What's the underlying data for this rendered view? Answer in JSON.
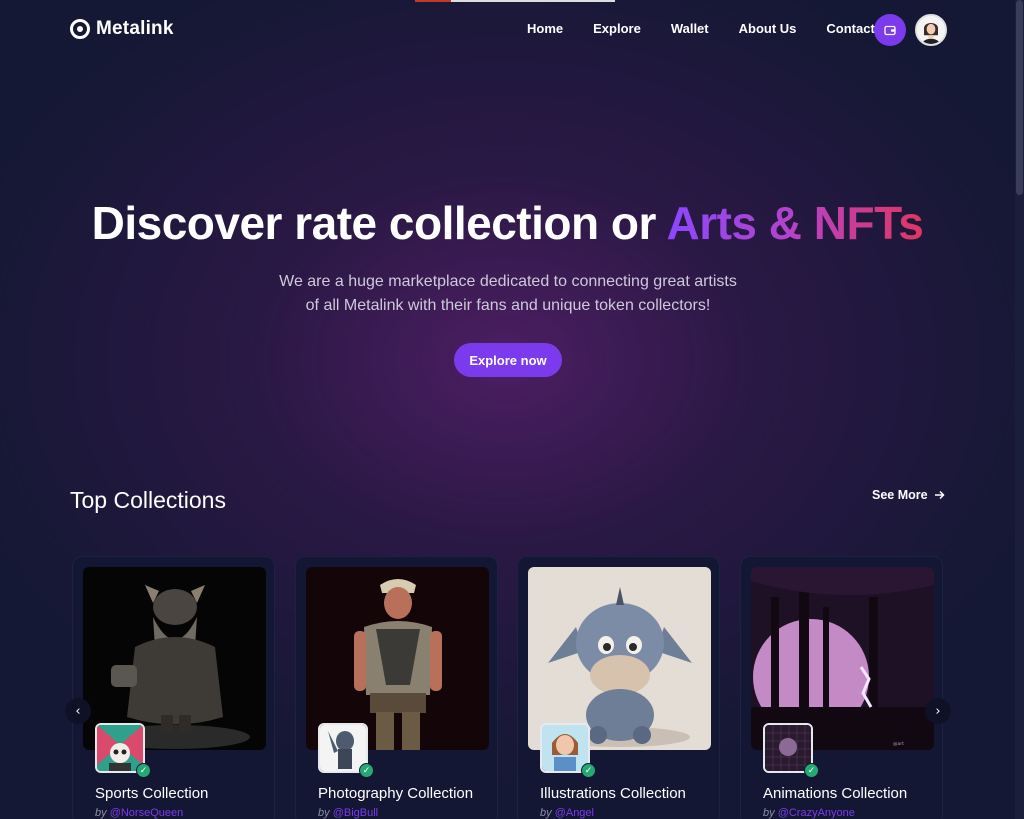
{
  "brand": {
    "name": "Metalink"
  },
  "nav": {
    "items": [
      "Home",
      "Explore",
      "Wallet",
      "About Us",
      "Contact"
    ]
  },
  "hero": {
    "title_main": "Discover rate collection or",
    "title_highlight": "Arts & NFTs",
    "subtitle_line1": "We are a huge marketplace dedicated to connecting great artists",
    "subtitle_line2": "of all Metalink with their fans and unique token collectors!",
    "cta": "Explore now"
  },
  "collections": {
    "title": "Top Collections",
    "see_more": "See More",
    "items": [
      {
        "name": "Sports Collection",
        "by": "by",
        "handle": "@NorseQueen"
      },
      {
        "name": "Photography Collection",
        "by": "by",
        "handle": "@BigBull"
      },
      {
        "name": "Illustrations Collection",
        "by": "by",
        "handle": "@Angel"
      },
      {
        "name": "Animations Collection",
        "by": "by",
        "handle": "@CrazyAnyone"
      }
    ]
  },
  "icons": [
    "logo-icon",
    "wallet-icon",
    "avatar",
    "arrow-right-icon",
    "chevron-left-icon",
    "chevron-right-icon",
    "verified-check-icon"
  ],
  "colors": {
    "accent": "#7c3aed",
    "gradient_start": "#8b47ff",
    "gradient_end": "#e0365f",
    "background": "#151834",
    "verified": "#25a873"
  }
}
